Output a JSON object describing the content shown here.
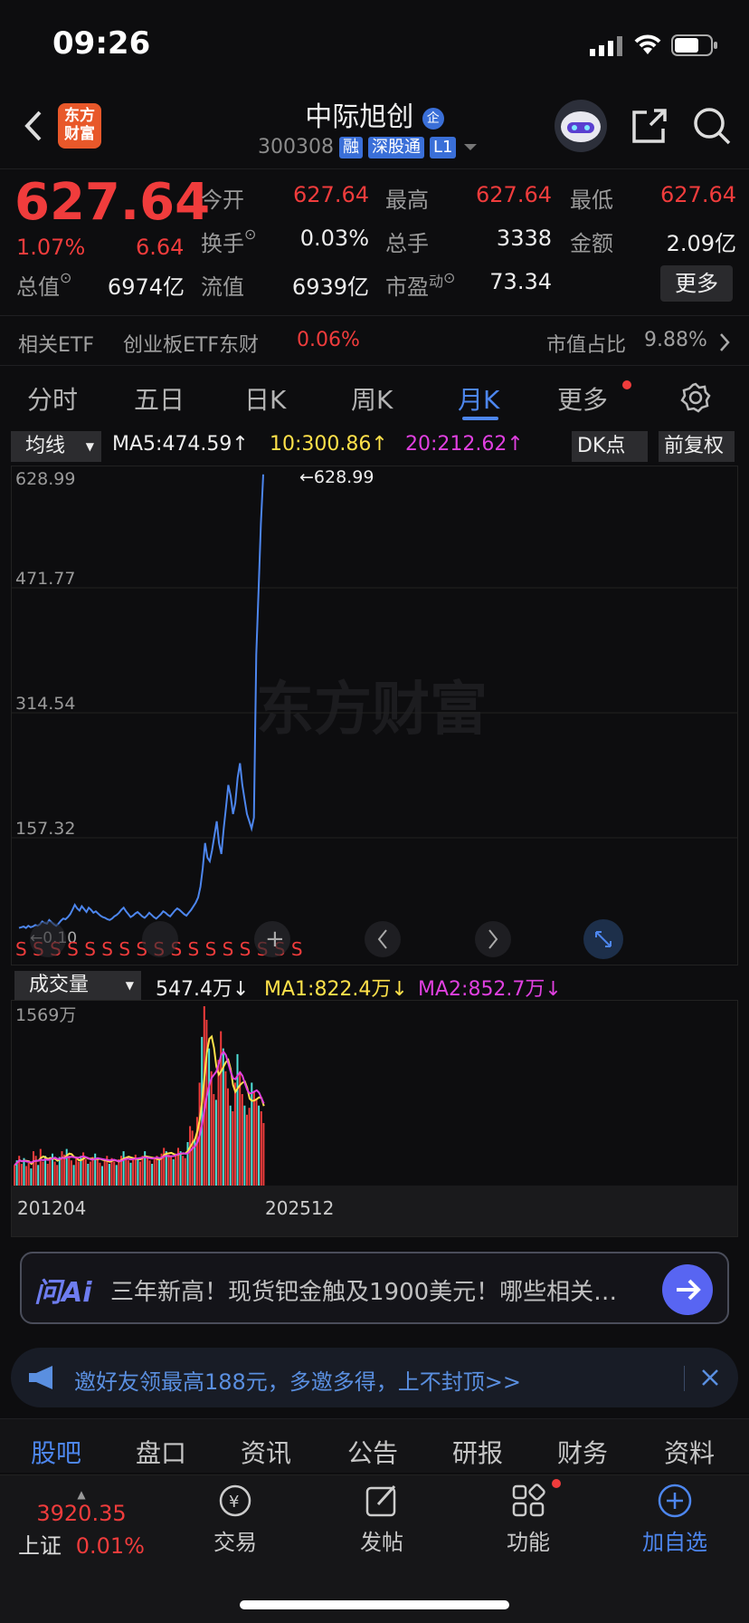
{
  "status": {
    "time": "09:26"
  },
  "header": {
    "logo_line1": "东方",
    "logo_line2": "财富",
    "stock_name": "中际旭创",
    "stock_code": "300308",
    "tags": [
      "融",
      "深股通",
      "L1"
    ],
    "badge": "企"
  },
  "quote": {
    "price": "627.64",
    "change_pct": "1.07%",
    "change": "6.64",
    "fields": [
      {
        "label": "今开",
        "value": "627.64",
        "color": "#f03c3c"
      },
      {
        "label": "最高",
        "value": "627.64",
        "color": "#f03c3c"
      },
      {
        "label": "最低",
        "value": "627.64",
        "color": "#f03c3c"
      },
      {
        "label": "换手",
        "value": "0.03%",
        "color": "#ededed"
      },
      {
        "label": "总手",
        "value": "3338",
        "color": "#ededed"
      },
      {
        "label": "金额",
        "value": "2.09亿",
        "color": "#ededed"
      },
      {
        "label": "总值",
        "value": "6974亿",
        "color": "#ededed"
      },
      {
        "label": "流值",
        "value": "6939亿",
        "color": "#ededed"
      },
      {
        "label": "市盈",
        "label_sup": "动",
        "value": "73.34",
        "color": "#ededed"
      }
    ],
    "more_label": "更多"
  },
  "etf": {
    "label": "相关ETF",
    "name": "创业板ETF东财",
    "change": "0.06%",
    "share_label": "市值占比",
    "share_value": "9.88%"
  },
  "period_tabs": [
    "分时",
    "五日",
    "日K",
    "周K",
    "月K",
    "更多"
  ],
  "active_period": "月K",
  "chart_toolbar": {
    "indicator": "均线",
    "ma5": "MA5:474.59↑",
    "ma10": "10:300.86↑",
    "ma20": "20:212.62↑",
    "dk": "DK点",
    "adjust": "前复权"
  },
  "chart_data": {
    "type": "line",
    "y_ticks": [
      "628.99",
      "471.77",
      "314.54",
      "157.32"
    ],
    "ylim": [
      0,
      628.99
    ],
    "max_label": "←628.99",
    "min_label": "←0.10",
    "x_labels": [
      "201204",
      "202512"
    ],
    "watermark": "东方财富",
    "price_series": [
      3,
      4,
      5,
      3,
      6,
      4,
      5,
      7,
      6,
      8,
      12,
      10,
      9,
      14,
      11,
      8,
      6,
      9,
      13,
      16,
      15,
      18,
      22,
      28,
      35,
      30,
      27,
      33,
      29,
      25,
      31,
      28,
      24,
      26,
      23,
      20,
      18,
      17,
      15,
      14,
      16,
      19,
      21,
      24,
      28,
      31,
      26,
      22,
      18,
      20,
      23,
      25,
      22,
      19,
      17,
      20,
      24,
      21,
      18,
      16,
      19,
      22,
      26,
      24,
      21,
      19,
      23,
      27,
      30,
      28,
      25,
      22,
      20,
      24,
      28,
      33,
      38,
      45,
      60,
      85,
      120,
      100,
      95,
      110,
      130,
      150,
      120,
      105,
      140,
      170,
      200,
      185,
      160,
      175,
      210,
      230,
      200,
      180,
      160,
      150,
      140,
      155,
      380,
      470,
      560,
      628
    ],
    "volume_label": "成交量",
    "volume_current": "547.4万↓",
    "volume_ma1": "MA1:822.4万↓",
    "volume_ma2": "MA2:852.7万↓",
    "volume_max_label": "1569万",
    "volume_max": 1569,
    "volumes": [
      180,
      220,
      260,
      190,
      240,
      170,
      200,
      150,
      300,
      260,
      180,
      320,
      210,
      260,
      190,
      230,
      280,
      210,
      180,
      250,
      300,
      270,
      320,
      260,
      220,
      180,
      240,
      210,
      260,
      290,
      230,
      190,
      210,
      250,
      280,
      230,
      200,
      170,
      220,
      260,
      190,
      240,
      210,
      180,
      230,
      260,
      300,
      250,
      220,
      200,
      230,
      270,
      240,
      210,
      260,
      300,
      250,
      220,
      190,
      240,
      260,
      230,
      280,
      330,
      300,
      270,
      250,
      230,
      280,
      330,
      300,
      260,
      240,
      380,
      520,
      480,
      410,
      600,
      900,
      1300,
      1569,
      1450,
      1200,
      1000,
      800,
      750,
      1100,
      1350,
      1200,
      1000,
      850,
      700,
      650,
      900,
      1150,
      1000,
      800,
      700,
      620,
      680,
      900,
      820,
      760,
      700,
      650,
      547
    ],
    "volume_colors": "red/cyan alternating by candle direction"
  },
  "ai": {
    "logo": "问Ai",
    "text": "三年新高！现货钯金触及1900美元！哪些相关…"
  },
  "invite": {
    "text": "邀好友领最高188元，多邀多得，上不封顶>>"
  },
  "section_tabs": [
    "股吧",
    "盘口",
    "资讯",
    "公告",
    "研报",
    "财务",
    "资料"
  ],
  "active_section": "股吧",
  "bottom_nav": {
    "index_value": "3920.35",
    "index_name": "上证",
    "index_change": "0.01%",
    "items": [
      "交易",
      "发帖",
      "功能",
      "加自选"
    ]
  },
  "colors": {
    "up": "#f03c3c",
    "accent": "#4d86ee",
    "ma10": "#ffe14a",
    "ma20": "#e040e0",
    "cyan": "#4fe0d8"
  }
}
